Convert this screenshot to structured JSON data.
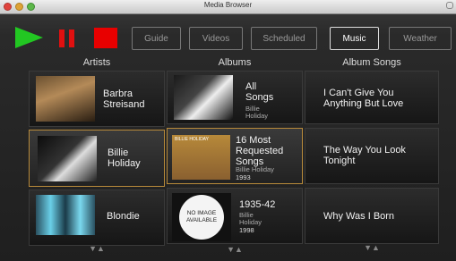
{
  "window": {
    "title": "Media Browser"
  },
  "toolbar": {
    "buttons": [
      {
        "label": "Guide"
      },
      {
        "label": "Videos"
      },
      {
        "label": "Scheduled"
      },
      {
        "label": "Music",
        "active": true
      },
      {
        "label": "Weather"
      }
    ]
  },
  "columns": {
    "artists": "Artists",
    "albums": "Albums",
    "songs": "Album Songs"
  },
  "artists": [
    {
      "name": "Barbra\nStreisand"
    },
    {
      "name": "Billie\nHoliday",
      "selected": true
    },
    {
      "name": "Blondie"
    }
  ],
  "albums": [
    {
      "title": "All\nSongs",
      "artist": "Billie\nHoliday",
      "year": ""
    },
    {
      "title": "16 Most\nRequested\nSongs",
      "artist": "Billie Holiday",
      "year": "1993",
      "cover_text": "BILLIE HOLIDAY",
      "selected": true
    },
    {
      "title": "1935-42",
      "artist": "Billie\nHoliday",
      "year": "1998",
      "placeholder": "NO IMAGE\nAVAILABLE"
    }
  ],
  "songs": [
    {
      "title": "I Can't Give You\nAnything But Love"
    },
    {
      "title": "The Way You Look\nTonight"
    },
    {
      "title": "Why Was I Born"
    }
  ],
  "arrows": "▼▲",
  "colors": {
    "play": "#22c722",
    "pause": "#e01010",
    "stop": "#e80000",
    "selection": "#b88a3a"
  }
}
